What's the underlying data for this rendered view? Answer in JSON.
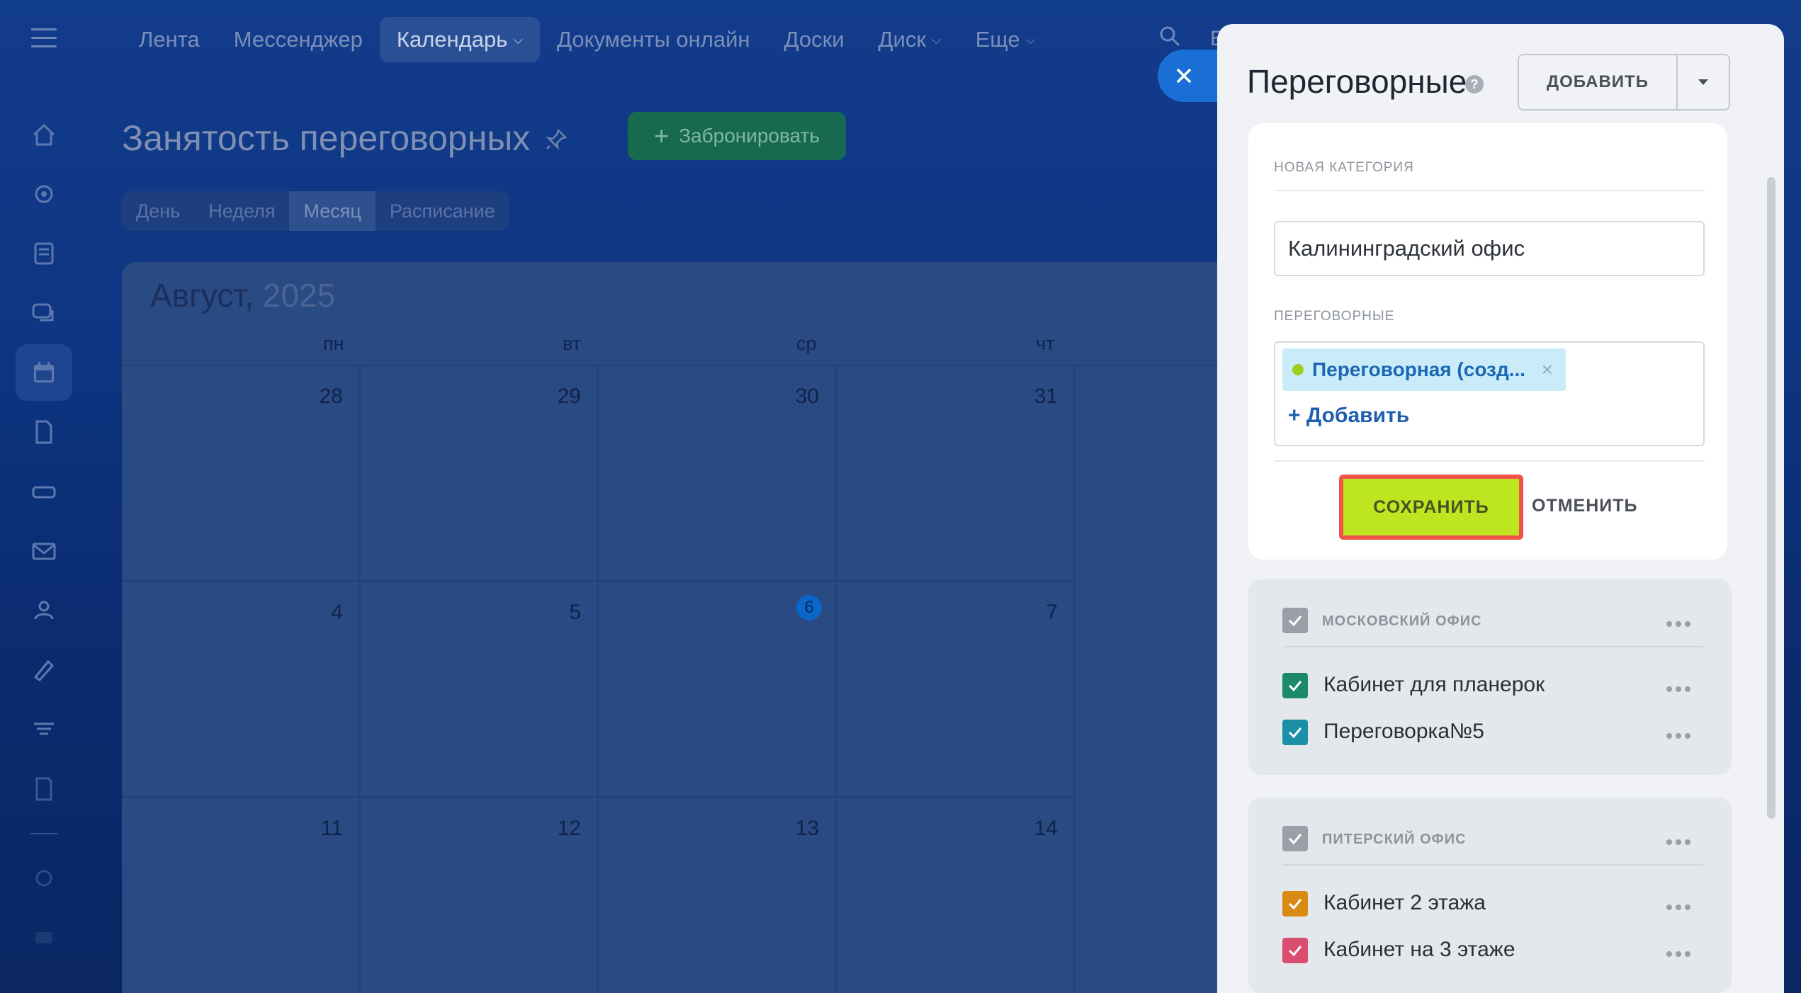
{
  "topnav": {
    "items": [
      "Лента",
      "Мессенджер",
      "Календарь",
      "Документы онлайн",
      "Доски",
      "Диск",
      "Еще"
    ],
    "cut_letter": "Б"
  },
  "page": {
    "title": "Занятость переговорных",
    "book_button": "Забронировать",
    "view_tabs": [
      "День",
      "Неделя",
      "Месяц",
      "Расписание"
    ],
    "active_view": "Месяц"
  },
  "calendar": {
    "month": "Август,",
    "year": "2025",
    "weekdays": [
      "пн",
      "вт",
      "ср",
      "чт"
    ],
    "weeks": [
      [
        "28",
        "29",
        "30",
        "31"
      ],
      [
        "4",
        "5",
        "6",
        "7"
      ],
      [
        "11",
        "12",
        "13",
        "14"
      ]
    ],
    "today": "6"
  },
  "panel": {
    "title": "Переговорные",
    "help": "?",
    "add_button": "ДОБАВИТЬ",
    "form": {
      "new_category_label": "НОВАЯ КАТЕГОРИЯ",
      "category_value": "Калининградский офис",
      "rooms_label": "ПЕРЕГОВОРНЫЕ",
      "room_chip": "Переговорная (созд...",
      "chip_remove": "×",
      "add_room_link": "+ Добавить",
      "save": "СОХРАНИТЬ",
      "cancel": "ОТМЕНИТЬ"
    },
    "sections": [
      {
        "title": "МОСКОВСКИЙ ОФИС",
        "rooms": [
          {
            "name": "Кабинет для планерок",
            "color": "#1a8a6a"
          },
          {
            "name": "Переговорка№5",
            "color": "#1b8fa6"
          }
        ]
      },
      {
        "title": "ПИТЕРСКИЙ ОФИС",
        "rooms": [
          {
            "name": "Кабинет 2 этажа",
            "color": "#d98a12"
          },
          {
            "name": "Кабинет на 3 этаже",
            "color": "#d94d6e"
          }
        ]
      }
    ]
  }
}
